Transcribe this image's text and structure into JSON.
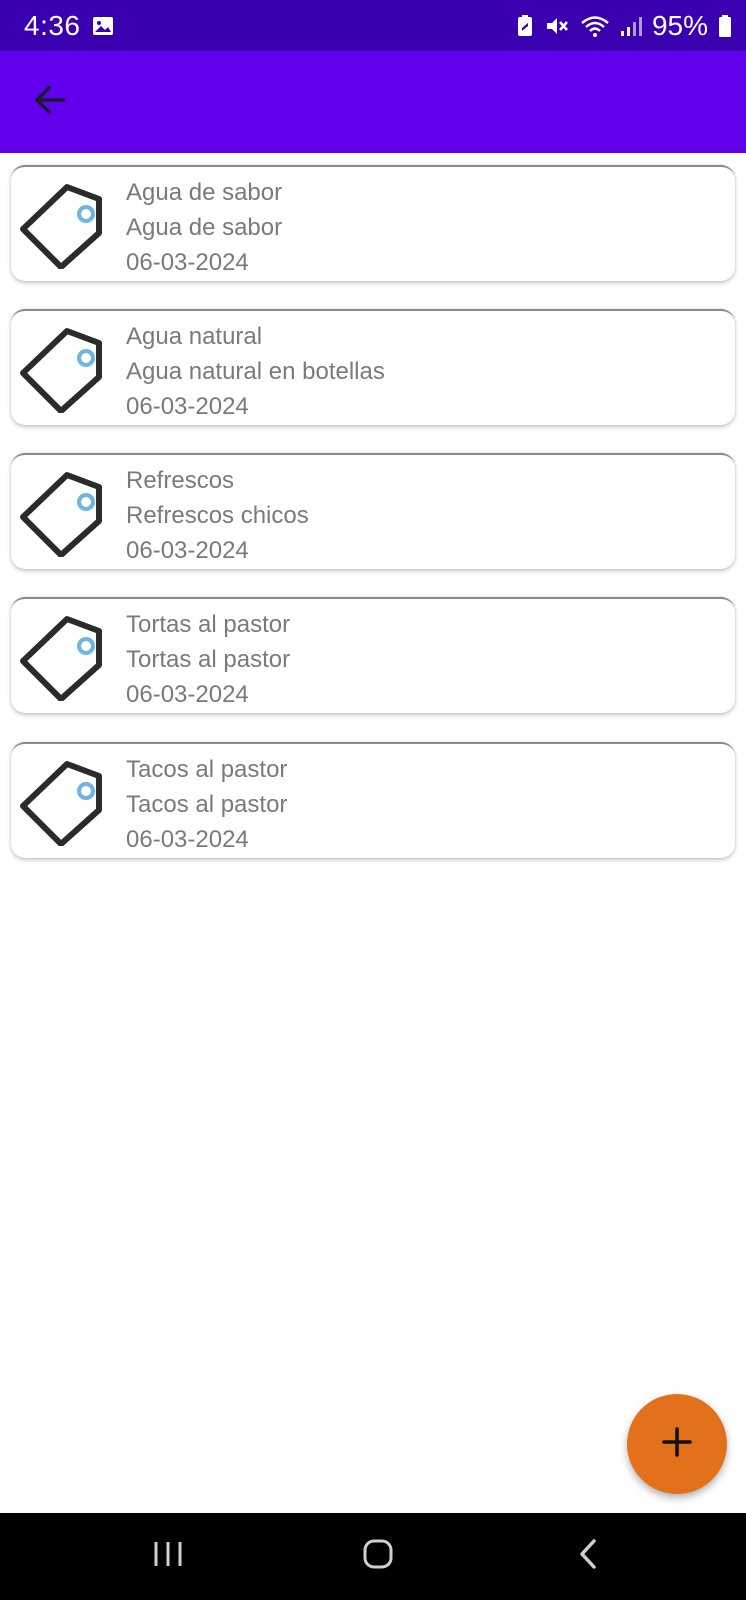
{
  "status_bar": {
    "time": "4:36",
    "battery_text": "95%",
    "icons": [
      "image-icon",
      "battery-saver-icon",
      "mute-icon",
      "wifi-icon",
      "signal-icon",
      "battery-icon"
    ]
  },
  "app_bar": {
    "background": "#6200ee",
    "back_icon": "arrow-back-icon"
  },
  "items": [
    {
      "name": "Agua de sabor",
      "description": "Agua de sabor",
      "date": "06-03-2024",
      "icon": "price-tag-icon"
    },
    {
      "name": "Agua natural",
      "description": "Agua natural en botellas",
      "date": "06-03-2024",
      "icon": "price-tag-icon"
    },
    {
      "name": "Refrescos",
      "description": "Refrescos chicos",
      "date": "06-03-2024",
      "icon": "price-tag-icon"
    },
    {
      "name": "Tortas al pastor",
      "description": "Tortas al pastor",
      "date": "06-03-2024",
      "icon": "price-tag-icon"
    },
    {
      "name": "Tacos al pastor",
      "description": "Tacos al pastor",
      "date": "06-03-2024",
      "icon": "price-tag-icon"
    }
  ],
  "fab": {
    "icon": "plus-icon",
    "color": "#e3701b"
  },
  "nav_bar": {
    "icons": [
      "recent-apps-icon",
      "home-icon",
      "back-icon"
    ]
  }
}
